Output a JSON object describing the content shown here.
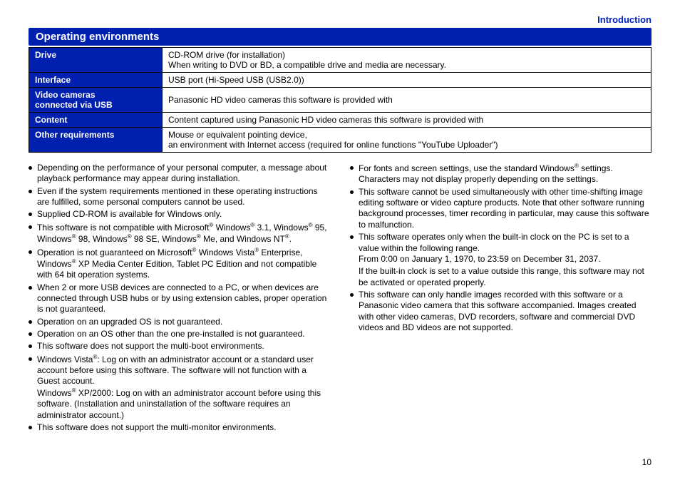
{
  "breadcrumb": "Introduction",
  "section_title": "Operating environments",
  "table": {
    "rows": [
      {
        "label": "Drive",
        "value_line1": "CD-ROM drive (for installation)",
        "value_line2": "When writing to DVD or BD, a compatible drive and media are necessary."
      },
      {
        "label": "Interface",
        "value_line1": "USB port (Hi-Speed USB (USB2.0))"
      },
      {
        "label_line1": "Video cameras",
        "label_line2": "connected via USB",
        "value_line1": "Panasonic HD video cameras this software is provided with"
      },
      {
        "label": "Content",
        "value_line1": "Content captured using Panasonic HD video cameras this software is provided with"
      },
      {
        "label": "Other requirements",
        "value_line1": "Mouse or equivalent pointing device,",
        "value_line2": "an environment with Internet access (required for online functions \"YouTube Uploader\")"
      }
    ]
  },
  "left_bullets": {
    "b0": "Depending on the performance of your personal computer, a message about playback performance may appear during installation.",
    "b1": "Even if the system requirements mentioned in these operating instructions are fulfilled, some personal computers cannot be used.",
    "b2": "Supplied CD-ROM is available for Windows only.",
    "b3_a": "This software is not compatible with Microsoft",
    "b3_b": " Windows",
    "b3_c": " 3.1, Windows",
    "b3_d": " 95, Windows",
    "b3_e": " 98, Windows",
    "b3_f": " 98 SE, Windows",
    "b3_g": " Me, and Windows NT",
    "b3_h": ".",
    "b4_a": "Operation is not guaranteed on Microsoft",
    "b4_b": " Windows Vista",
    "b4_c": " Enterprise, Windows",
    "b4_d": " XP Media Center Edition, Tablet PC Edition and not compatible with 64 bit operation systems.",
    "b5": "When 2 or more USB devices are connected to a PC, or when devices are connected through USB hubs or by using extension cables, proper operation is not guaranteed.",
    "b6": "Operation on an upgraded OS is not guaranteed.",
    "b7": "Operation on an OS other than the one pre-installed is not guaranteed.",
    "b8": "This software does not support the multi-boot environments.",
    "b9_a": "Windows Vista",
    "b9_b": ": Log on with an administrator account or a standard user account before using this software. The software will not function with a Guest account.",
    "b9_sub_a": "Windows",
    "b9_sub_b": " XP/2000: Log on with an administrator account before using this software. (Installation and uninstallation of the software requires an administrator account.)",
    "b10": "This software does not support the multi-monitor environments."
  },
  "right_bullets": {
    "b0_a": "For fonts and screen settings, use the standard Windows",
    "b0_b": " settings. Characters may not display properly depending on the settings.",
    "b1": "This software cannot be used simultaneously with other time-shifting image editing software or video capture products. Note that other software running background processes, timer recording in particular, may cause this software to malfunction.",
    "b2": "This software operates only when the built-in clock on the PC is set to a value within the following range.",
    "b2_sub1": "From 0:00 on January 1, 1970, to 23:59 on December 31, 2037.",
    "b2_sub2": "If the built-in clock is set to a value outside this range, this software may not be activated or operated properly.",
    "b3": "This software can only handle images recorded with this software or a Panasonic video camera that this software accompanied. Images created with other video cameras, DVD recorders, software and commercial DVD videos and BD videos are not supported."
  },
  "reg": "®",
  "page_number": "10"
}
